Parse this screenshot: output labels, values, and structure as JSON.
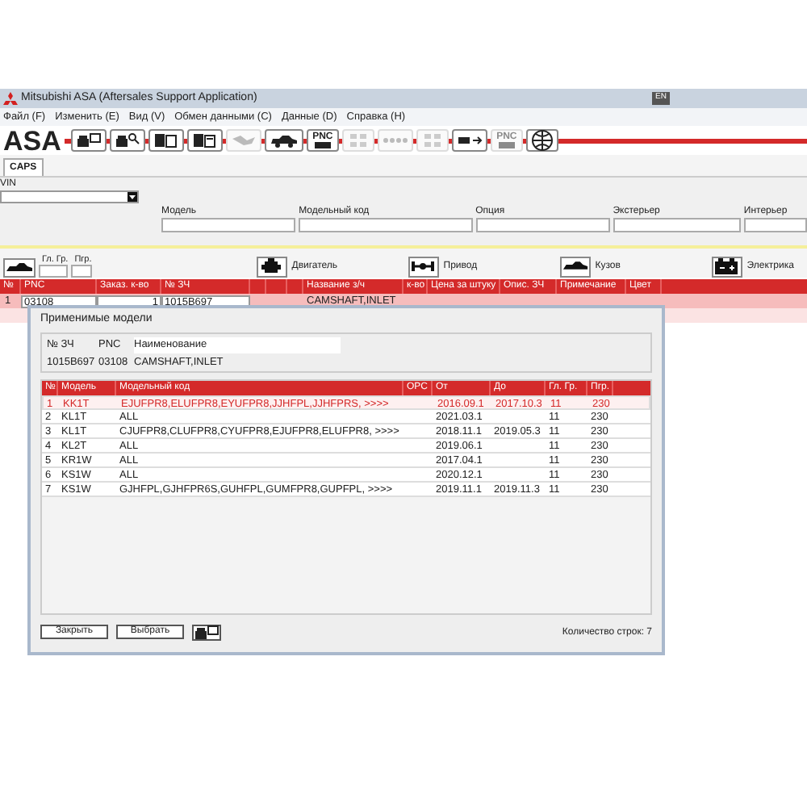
{
  "window": {
    "title": "Mitsubishi ASA (Aftersales Support Application)",
    "language": "EN"
  },
  "menu": [
    "Файл (F)",
    "Изменить (E)",
    "Вид (V)",
    "Обмен данными (C)",
    "Данные (D)",
    "Справка (H)"
  ],
  "logo": "ASA",
  "toolbar": [
    {
      "kind": "print-screen",
      "disabled": false
    },
    {
      "kind": "print-search",
      "disabled": false
    },
    {
      "kind": "copy",
      "disabled": false
    },
    {
      "kind": "copy-new",
      "disabled": false
    },
    {
      "kind": "hands",
      "disabled": true
    },
    {
      "kind": "car",
      "disabled": false
    },
    {
      "kind": "pnc",
      "label": "PNC",
      "disabled": false
    },
    {
      "kind": "grid",
      "disabled": true
    },
    {
      "kind": "dots",
      "disabled": true
    },
    {
      "kind": "grid",
      "disabled": true
    },
    {
      "kind": "truck",
      "disabled": false
    },
    {
      "kind": "pnc",
      "label": "PNC",
      "disabled": true
    },
    {
      "kind": "globe",
      "disabled": false
    }
  ],
  "tabs": [
    {
      "label": "CAPS",
      "selected": true
    }
  ],
  "vin": {
    "label": "VIN"
  },
  "filters": [
    {
      "label": "Модель"
    },
    {
      "label": "Модельный код"
    },
    {
      "label": "Опция"
    },
    {
      "label": "Экстерьер"
    },
    {
      "label": "Интерьер"
    }
  ],
  "groups": [
    {
      "label": "Гл. Гр."
    },
    {
      "label": "Пгр."
    }
  ],
  "categories": [
    {
      "label": "Двигатель",
      "kind": "engine"
    },
    {
      "label": "Привод",
      "kind": "axle"
    },
    {
      "label": "Кузов",
      "kind": "body"
    },
    {
      "label": "Электрика",
      "kind": "battery"
    }
  ],
  "parts_table": {
    "columns": [
      "№",
      "PNC",
      "Заказ. к-во",
      "№ ЗЧ",
      "Название з/ч",
      "к-во",
      "Цена за штуку",
      "Опис. ЗЧ",
      "Примечание",
      "Цвет"
    ],
    "rows": [
      {
        "no": "1",
        "pnc": "03108",
        "qty": "1",
        "part_no": "1015B697",
        "name": "CAMSHAFT,INLET",
        "selected": true
      }
    ]
  },
  "dialog": {
    "title": "Применимые модели",
    "part_columns": [
      "№ ЗЧ",
      "PNC",
      "Наименование"
    ],
    "part": [
      "1015B697",
      "03108",
      "CAMSHAFT,INLET"
    ],
    "columns": [
      "№",
      "Модель",
      "Модельный код",
      "OPC",
      "От",
      "До",
      "Гл. Гр.",
      "Пгр."
    ],
    "rows": [
      {
        "cells": [
          "1",
          "KK1T",
          "EJUFPR8,ELUFPR8,EYUFPR8,JJHFPL,JJHFPRS,   >>>>",
          "",
          "2016.09.1",
          "2017.10.3",
          "11",
          "230"
        ],
        "selected": true
      },
      {
        "cells": [
          "2",
          "KL1T",
          "ALL",
          "",
          "2021.03.1",
          "",
          "11",
          "230"
        ],
        "selected": false
      },
      {
        "cells": [
          "3",
          "KL1T",
          "CJUFPR8,CLUFPR8,CYUFPR8,EJUFPR8,ELUFPR8,   >>>>",
          "",
          "2018.11.1",
          "2019.05.3",
          "11",
          "230"
        ],
        "selected": false
      },
      {
        "cells": [
          "4",
          "KL2T",
          "ALL",
          "",
          "2019.06.1",
          "",
          "11",
          "230"
        ],
        "selected": false
      },
      {
        "cells": [
          "5",
          "KR1W",
          "ALL",
          "",
          "2017.04.1",
          "",
          "11",
          "230"
        ],
        "selected": false
      },
      {
        "cells": [
          "6",
          "KS1W",
          "ALL",
          "",
          "2020.12.1",
          "",
          "11",
          "230"
        ],
        "selected": false
      },
      {
        "cells": [
          "7",
          "KS1W",
          "GJHFPL,GJHFPR6S,GUHFPL,GUMFPR8,GUPFPL,   >>>>",
          "",
          "2019.11.1",
          "2019.11.3",
          "11",
          "230"
        ],
        "selected": false
      }
    ],
    "buttons": [
      "Закрыть",
      "Выбрать"
    ],
    "row_count": "Количество строк: 7"
  }
}
